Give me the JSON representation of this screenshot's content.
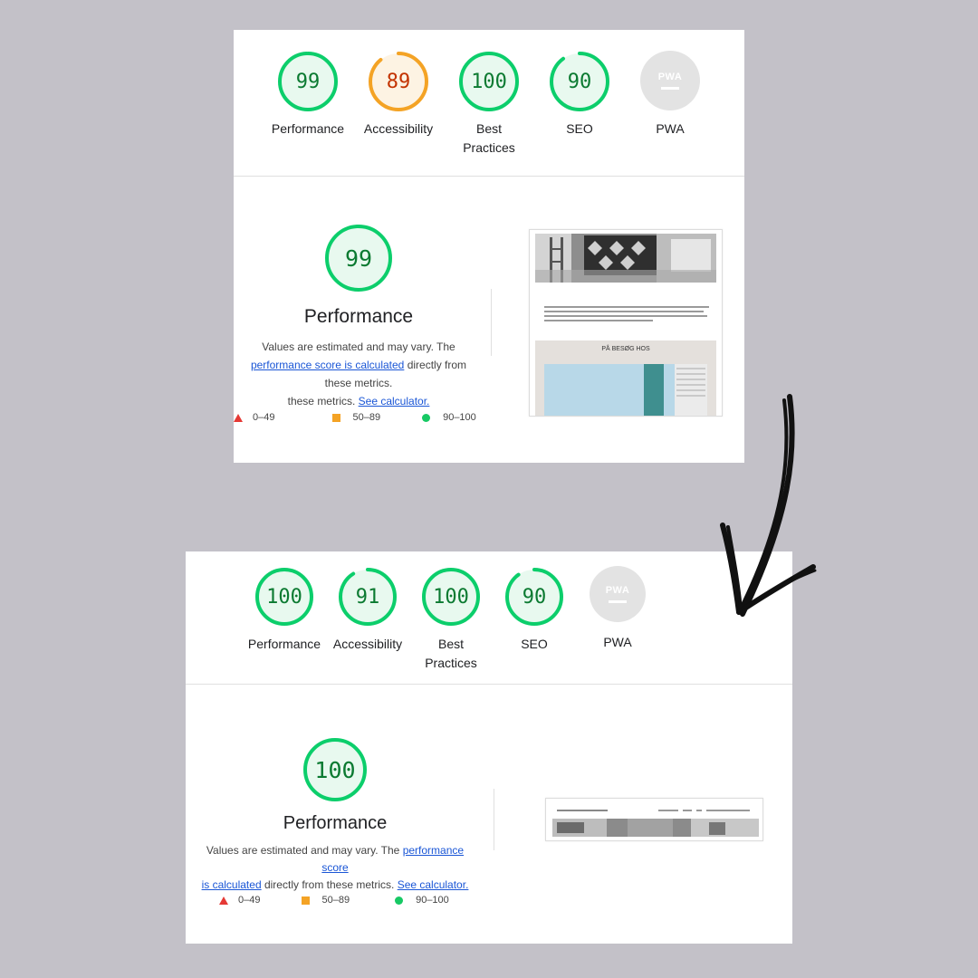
{
  "before": {
    "gauges": [
      {
        "score": "99",
        "label": "Performance",
        "fraction": 0.99,
        "color": "#0cce6b",
        "fill": "#e8f9ef",
        "text_color": "#0b7a31"
      },
      {
        "score": "89",
        "label": "Accessibility",
        "fraction": 0.89,
        "color": "#f4a325",
        "fill": "#fdf3e3",
        "text_color": "#c33300"
      },
      {
        "score": "100",
        "label": "Best Practices",
        "fraction": 1.0,
        "color": "#0cce6b",
        "fill": "#e8f9ef",
        "text_color": "#0b7a31"
      },
      {
        "score": "90",
        "label": "SEO",
        "fraction": 0.9,
        "color": "#0cce6b",
        "fill": "#e8f9ef",
        "text_color": "#0b7a31"
      }
    ],
    "pwa": {
      "badge": "PWA",
      "label": "PWA"
    },
    "performance": {
      "score": "99",
      "title": "Performance",
      "desc_1": "Values are estimated and may vary. The",
      "desc_link": "performance score is calculated",
      "desc_2": "directly from these metrics.",
      "desc_link2": "See calculator."
    },
    "legend": {
      "fail": "0–49",
      "average": "50–89",
      "pass": "90–100"
    },
    "screenshot": {
      "banner": "PÅ BESØG HOS"
    }
  },
  "after": {
    "gauges": [
      {
        "score": "100",
        "label": "Performance",
        "fraction": 1.0,
        "color": "#0cce6b",
        "fill": "#e8f9ef",
        "text_color": "#0b7a31"
      },
      {
        "score": "91",
        "label": "Accessibility",
        "fraction": 0.91,
        "color": "#0cce6b",
        "fill": "#e8f9ef",
        "text_color": "#0b7a31"
      },
      {
        "score": "100",
        "label": "Best Practices",
        "fraction": 1.0,
        "color": "#0cce6b",
        "fill": "#e8f9ef",
        "text_color": "#0b7a31"
      },
      {
        "score": "90",
        "label": "SEO",
        "fraction": 0.9,
        "color": "#0cce6b",
        "fill": "#e8f9ef",
        "text_color": "#0b7a31"
      }
    ],
    "pwa": {
      "badge": "PWA",
      "label": "PWA"
    },
    "performance": {
      "score": "100",
      "title": "Performance",
      "desc_1": "Values are estimated and may vary. The",
      "desc_link": "performance score",
      "desc_link_b": "is calculated",
      "desc_2": "directly from these metrics.",
      "desc_link2": "See calculator."
    },
    "legend": {
      "fail": "0–49",
      "average": "50–89",
      "pass": "90–100"
    }
  }
}
